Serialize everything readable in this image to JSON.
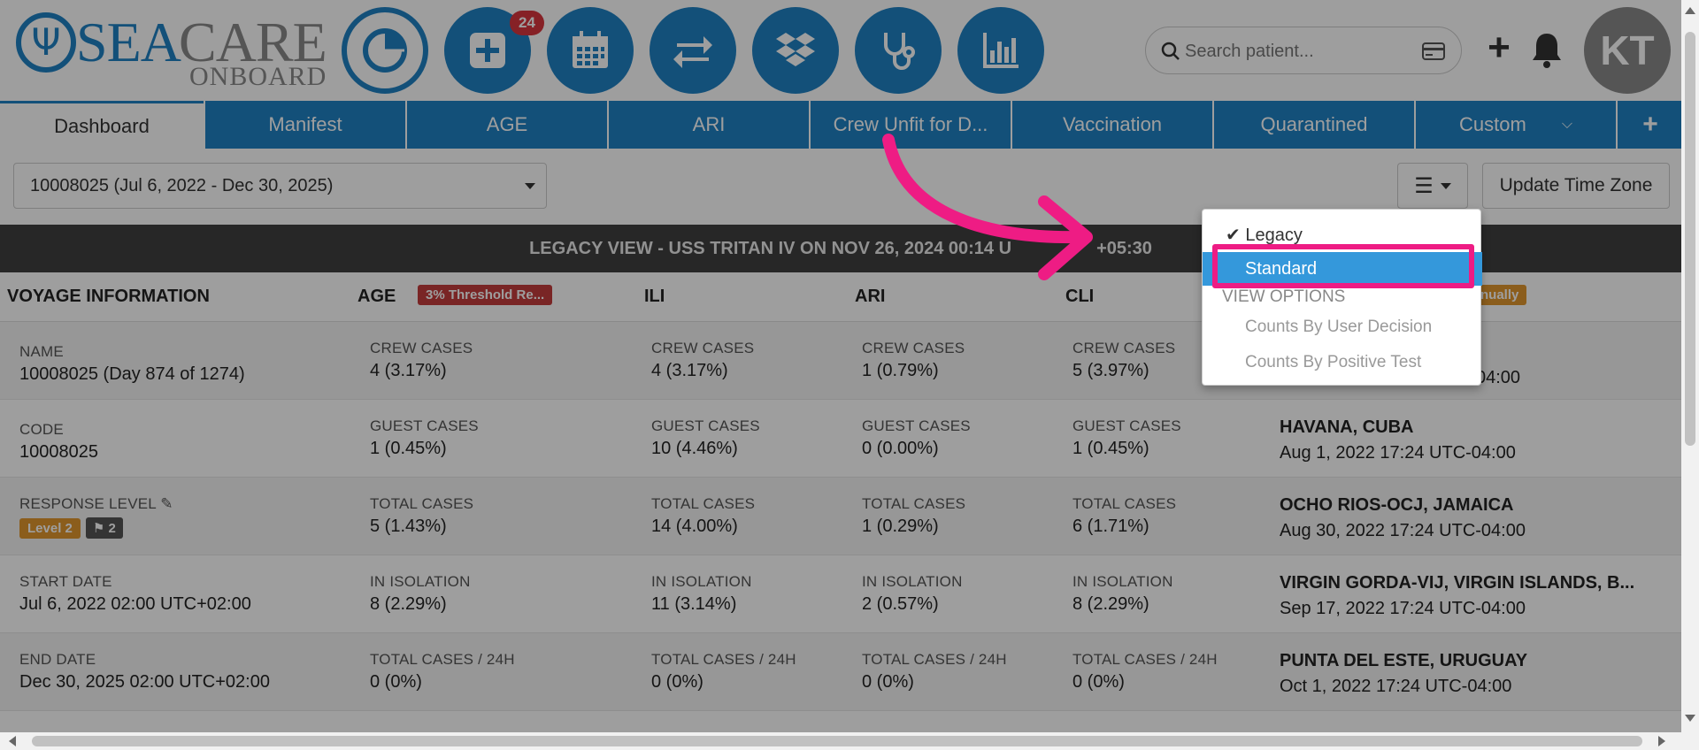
{
  "logo": {
    "sea": "SEA",
    "care": "CARE",
    "onboard": "ONBOARD"
  },
  "nav": {
    "badge_count": "24"
  },
  "search": {
    "placeholder": "Search patient..."
  },
  "user": {
    "initials": "KT"
  },
  "tabs": [
    {
      "label": "Dashboard"
    },
    {
      "label": "Manifest"
    },
    {
      "label": "AGE"
    },
    {
      "label": "ARI"
    },
    {
      "label": "Crew Unfit for D..."
    },
    {
      "label": "Vaccination"
    },
    {
      "label": "Quarantined"
    },
    {
      "label": "Custom"
    },
    {
      "label": "+"
    }
  ],
  "toolbar": {
    "voyage_selected": "10008025 (Jul 6, 2022 - Dec 30, 2025)",
    "update_tz": "Update Time Zone"
  },
  "legacy_bar": {
    "left": "LEGACY VIEW - USS TRITAN IV ON NOV 26, 2024 00:14 U",
    "right": "+05:30"
  },
  "sections": {
    "voyage": "VOYAGE INFORMATION",
    "age": "AGE",
    "age_chip": "3% Threshold Re...",
    "ili": "ILI",
    "ari": "ARI",
    "cli": "CLI",
    "ports_chip": "nually"
  },
  "dropdown": {
    "legacy": "Legacy",
    "standard": "Standard",
    "view_options": "VIEW OPTIONS",
    "counts_user": "Counts By User Decision",
    "counts_test": "Counts By Positive Test"
  },
  "voyage_info": {
    "name_label": "NAME",
    "name_value": "10008025 (Day 874 of 1274)",
    "code_label": "CODE",
    "code_value": "10008025",
    "response_label": "RESPONSE LEVEL",
    "response_level": "Level 2",
    "response_flags": "2",
    "start_label": "START DATE",
    "start_value": "Jul 6, 2022 02:00 UTC+02:00",
    "end_label": "END DATE",
    "end_value": "Dec 30, 2025 02:00 UTC+02:00"
  },
  "metric_labels": {
    "crew": "CREW CASES",
    "guest": "GUEST CASES",
    "total": "TOTAL CASES",
    "isolation": "IN ISOLATION",
    "total24": "TOTAL CASES / 24H"
  },
  "metrics": {
    "age": {
      "crew": "4 (3.17%)",
      "guest": "1 (0.45%)",
      "total": "5 (1.43%)",
      "isolation": "8 (2.29%)",
      "total24": "0 (0%)"
    },
    "ili": {
      "crew": "4 (3.17%)",
      "guest": "10 (4.46%)",
      "total": "14 (4.00%)",
      "isolation": "11 (3.14%)",
      "total24": "0 (0%)"
    },
    "ari": {
      "crew": "1 (0.79%)",
      "guest": "0 (0.00%)",
      "total": "1 (0.29%)",
      "isolation": "2 (0.57%)",
      "total24": "0 (0%)"
    },
    "cli": {
      "crew": "5 (3.97%)",
      "guest": "1 (0.45%)",
      "total": "6 (1.71%)",
      "isolation": "8 (2.29%)",
      "total24": "0 (0%)"
    }
  },
  "ports": {
    "row1_date_tail": "04:00",
    "row2_port": "HAVANA, CUBA",
    "row2_date": "Aug 1, 2022 17:24 UTC-04:00",
    "row3_port": "OCHO RIOS-OCJ, JAMAICA",
    "row3_date": "Aug 30, 2022 17:24 UTC-04:00",
    "row4_port": "VIRGIN GORDA-VIJ, VIRGIN ISLANDS, B...",
    "row4_date": "Sep 17, 2022 17:24 UTC-04:00",
    "row5_port": "PUNTA DEL ESTE, URUGUAY",
    "row5_date": "Oct 1, 2022 17:24 UTC-04:00"
  },
  "colors": {
    "brand": "#1f82c4",
    "highlight": "#ee1c84",
    "selected": "#3498db"
  }
}
